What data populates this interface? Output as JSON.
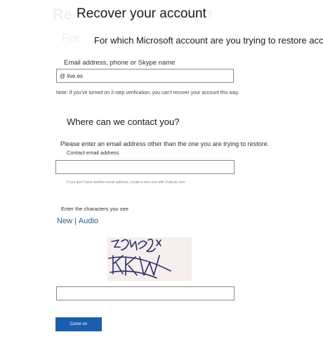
{
  "header": {
    "title": "Recover your account",
    "subtitle": "For which Microsoft account are you trying to restore acce"
  },
  "account": {
    "label": "Email address, phone or Skype name",
    "value": "@ live.es",
    "note": "Note: If you've turned on 2-step verification, you can't recover your account this way."
  },
  "contact": {
    "heading": "Where can we contact you?",
    "instruction": "Please enter an email address other than the one you are trying to restore.",
    "label": "Contact email address",
    "value": "",
    "hint": "If you don't have another email address, create a new one with Outlook.com"
  },
  "captcha": {
    "label": "Enter the characters you see",
    "new_label": "New",
    "separator": "|",
    "audio_label": "Audio",
    "value": ""
  },
  "submit": {
    "label": "Come on"
  }
}
